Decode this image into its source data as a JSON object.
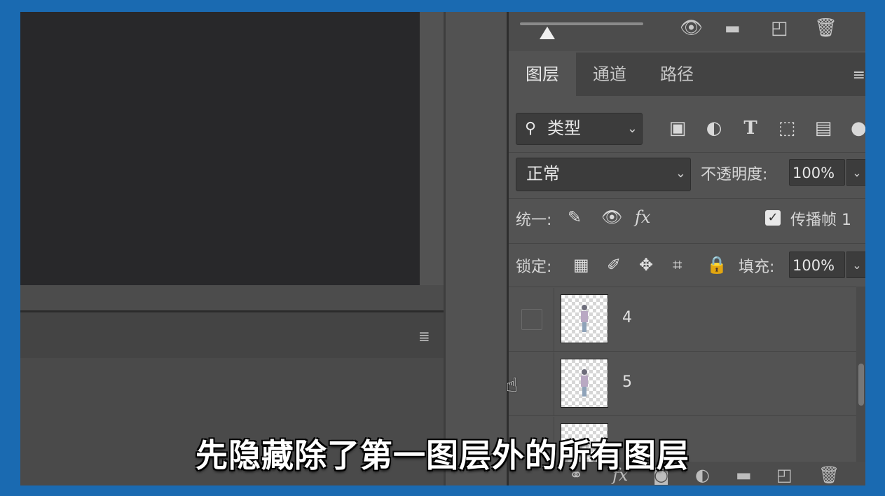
{
  "panel": {
    "tabs": [
      {
        "label": "图层",
        "active": true
      },
      {
        "label": "通道",
        "active": false
      },
      {
        "label": "路径",
        "active": false
      }
    ],
    "filter": {
      "label": "类型"
    },
    "blend_mode": {
      "value": "正常"
    },
    "opacity": {
      "label": "不透明度:",
      "value": "100%"
    },
    "unify": {
      "label": "统一:",
      "propagate_label": "传播帧 1",
      "propagate_checked": true
    },
    "lock": {
      "label": "锁定:"
    },
    "fill": {
      "label": "填充:",
      "value": "100%"
    },
    "layers": [
      {
        "name": "4",
        "visible": false
      },
      {
        "name": "5",
        "visible": false
      }
    ],
    "icons": {
      "top": [
        "eye-brush-icon",
        "folder-icon",
        "new-layer-icon",
        "trash-icon"
      ],
      "filter": [
        "image-filter-icon",
        "adjustment-filter-icon",
        "type-filter-icon",
        "shape-filter-icon",
        "smart-object-filter-icon"
      ],
      "unify": [
        "unify-position-icon",
        "unify-visibility-icon",
        "unify-style-icon"
      ],
      "lock": [
        "lock-transparent-icon",
        "lock-paint-icon",
        "lock-position-icon",
        "lock-artboard-icon",
        "lock-all-icon"
      ],
      "bottom": [
        "link-icon",
        "fx-icon",
        "mask-icon",
        "adjustment-icon",
        "group-folder-icon",
        "new-layer-icon",
        "delete-icon"
      ]
    }
  },
  "subtitle": "先隐藏除了第一图层外的所有图层",
  "colors": {
    "frame": "#1a6ab1",
    "panel_bg": "#535353",
    "canvas_bg": "#28282a"
  }
}
